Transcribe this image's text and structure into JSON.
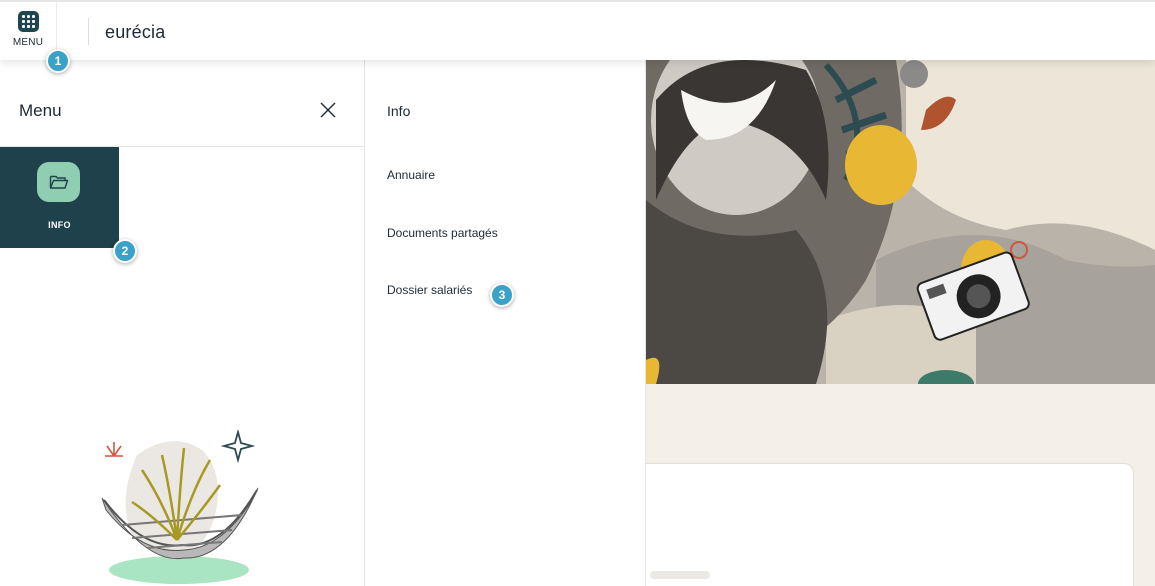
{
  "header": {
    "menu_label": "MENU",
    "brand": "eurécia"
  },
  "menu_panel": {
    "title": "Menu",
    "close_icon": "close-icon",
    "tiles": [
      {
        "label": "INFO",
        "icon": "folder-open-icon",
        "selected": true
      }
    ]
  },
  "submenu": {
    "title": "Info",
    "items": [
      "Annuaire",
      "Documents partagés",
      "Dossier salariés"
    ]
  },
  "callouts": [
    "1",
    "2",
    "3"
  ],
  "colors": {
    "tile_background": "#1e414b",
    "tile_icon_background": "#8fceb0",
    "menu_button": "#1f4650",
    "callout": "#3aa2c8",
    "page_background": "#f4f0e9"
  }
}
